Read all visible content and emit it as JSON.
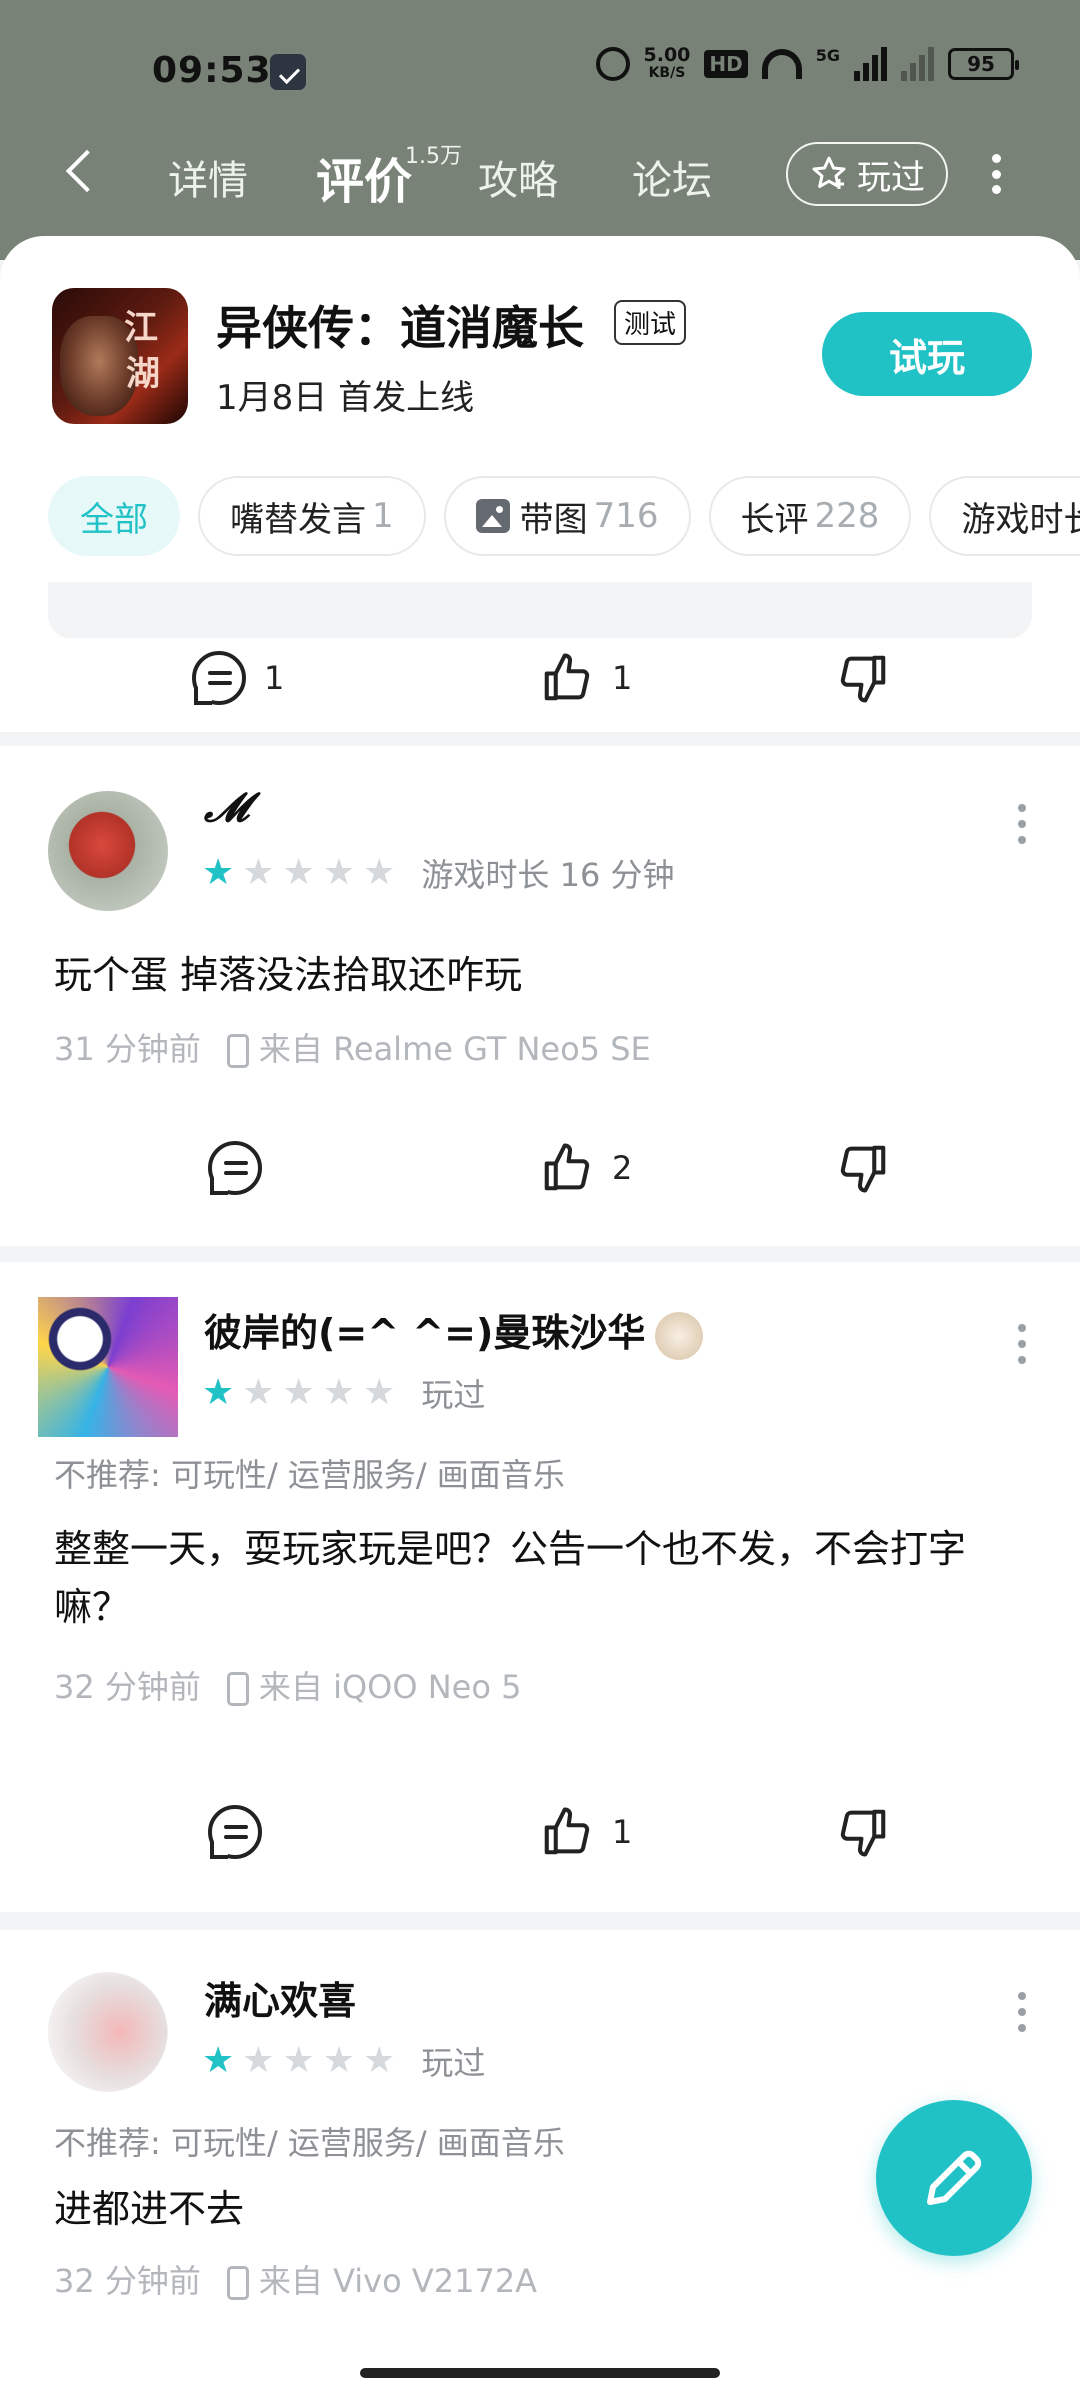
{
  "status_bar": {
    "time": "09:53",
    "speed": "5.00",
    "speed_unit": "KB/S",
    "hd": "HD",
    "net": "5G",
    "battery": "95"
  },
  "nav": {
    "tabs": [
      {
        "label": "详情"
      },
      {
        "label": "评价"
      },
      {
        "label": "攻略"
      },
      {
        "label": "论坛"
      }
    ],
    "review_count_badge": "1.5万",
    "played_label": "玩过"
  },
  "game": {
    "cover_text_1": "江",
    "cover_text_2": "湖",
    "title": "异侠传：道消魔长",
    "tag": "测试",
    "subtitle": "1月8日 首发上线",
    "try_label": "试玩"
  },
  "filters": [
    {
      "label": "全部",
      "count": ""
    },
    {
      "label": "嘴替发言",
      "count": "1"
    },
    {
      "label": "带图",
      "count": "716"
    },
    {
      "label": "长评",
      "count": "228"
    },
    {
      "label": "游戏时长",
      "count": ""
    }
  ],
  "previous_card": {
    "comments": "1",
    "likes": "1"
  },
  "reviews": [
    {
      "username": "𝓜",
      "stars": 1,
      "meta": "游戏时长 16 分钟",
      "content": "玩个蛋 掉落没法拾取还咋玩",
      "time": "31 分钟前",
      "device": "来自 Realme GT Neo5 SE",
      "comments": "",
      "likes": "2"
    },
    {
      "username": "彼岸的(=^ ^=)曼珠沙华",
      "stars": 1,
      "meta": "玩过",
      "tags": "不推荐: 可玩性/ 运营服务/ 画面音乐",
      "content": "整整一天，耍玩家玩是吧？公告一个也不发，不会打字嘛？",
      "time": "32 分钟前",
      "device": "来自 iQOO Neo 5",
      "comments": "",
      "likes": "1"
    },
    {
      "username": "满心欢喜",
      "stars": 1,
      "meta": "玩过",
      "tags": "不推荐: 可玩性/ 运营服务/ 画面音乐",
      "content": "进都进不去",
      "time": "32 分钟前",
      "device": "来自 Vivo V2172A"
    }
  ],
  "colors": {
    "accent": "#21c2c6",
    "header_bg": "#788276"
  }
}
